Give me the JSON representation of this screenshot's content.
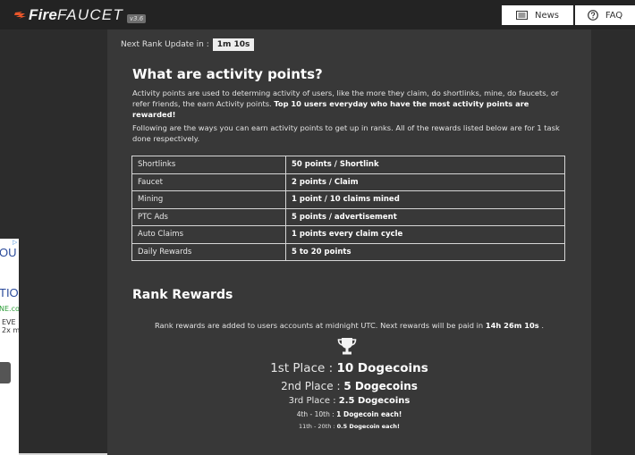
{
  "header": {
    "logo_fire": "Fire",
    "logo_faucet": "FAUCET",
    "version": "v3.6",
    "news_label": "News",
    "faq_label": "FAQ"
  },
  "ad": {
    "text1": "OU",
    "text2": "TION",
    "text3": "NE.co",
    "text4_line1": "EVE",
    "text4_line2": "2x m"
  },
  "rank_update": {
    "label": "Next Rank Update in :",
    "timer": "1m 10s"
  },
  "activity": {
    "title": "What are activity points?",
    "para1_normal": "Activity points are used to determing activity of users, like the more they claim, do shortlinks, mine, do faucets, or refer friends, the earn Activity points. ",
    "para1_bold": "Top 10 users everyday who have the most activity points are rewarded!",
    "para2": "Following are the ways you can earn activity points to get up in ranks. All of the rewards listed below are for 1 task done respectively.",
    "rows": [
      {
        "task": "Shortlinks",
        "reward": "50 points / Shortlink"
      },
      {
        "task": "Faucet",
        "reward": "2 points / Claim"
      },
      {
        "task": "Mining",
        "reward": "1 point / 10 claims mined"
      },
      {
        "task": "PTC Ads",
        "reward": "5 points / advertisement"
      },
      {
        "task": "Auto Claims",
        "reward": "1 points every claim cycle"
      },
      {
        "task": "Daily Rewards",
        "reward": "5 to 20 points"
      }
    ]
  },
  "rank_rewards": {
    "title": "Rank Rewards",
    "info_prefix": "Rank rewards are added to users accounts at midnight UTC. Next rewards will be paid in ",
    "info_time": "14h 26m 10s",
    "info_suffix": " .",
    "places": [
      {
        "label": "1st Place : ",
        "reward": "10 Dogecoins"
      },
      {
        "label": "2nd Place : ",
        "reward": "5 Dogecoins"
      },
      {
        "label": "3rd Place : ",
        "reward": "2.5 Dogecoins"
      },
      {
        "label": "4th - 10th : ",
        "reward": "1 Dogecoin each!"
      },
      {
        "label": "11th - 20th : ",
        "reward": "0.5 Dogecoin each!"
      }
    ]
  },
  "colors": {
    "background": "#2c2c2c",
    "panel": "#383838",
    "topbar": "#232323",
    "logo_flame": "#e8562a"
  },
  "icons": {
    "logo": "flame-icon",
    "news": "newspaper-icon",
    "faq": "question-circle-icon",
    "rank": "trophy-icon"
  }
}
